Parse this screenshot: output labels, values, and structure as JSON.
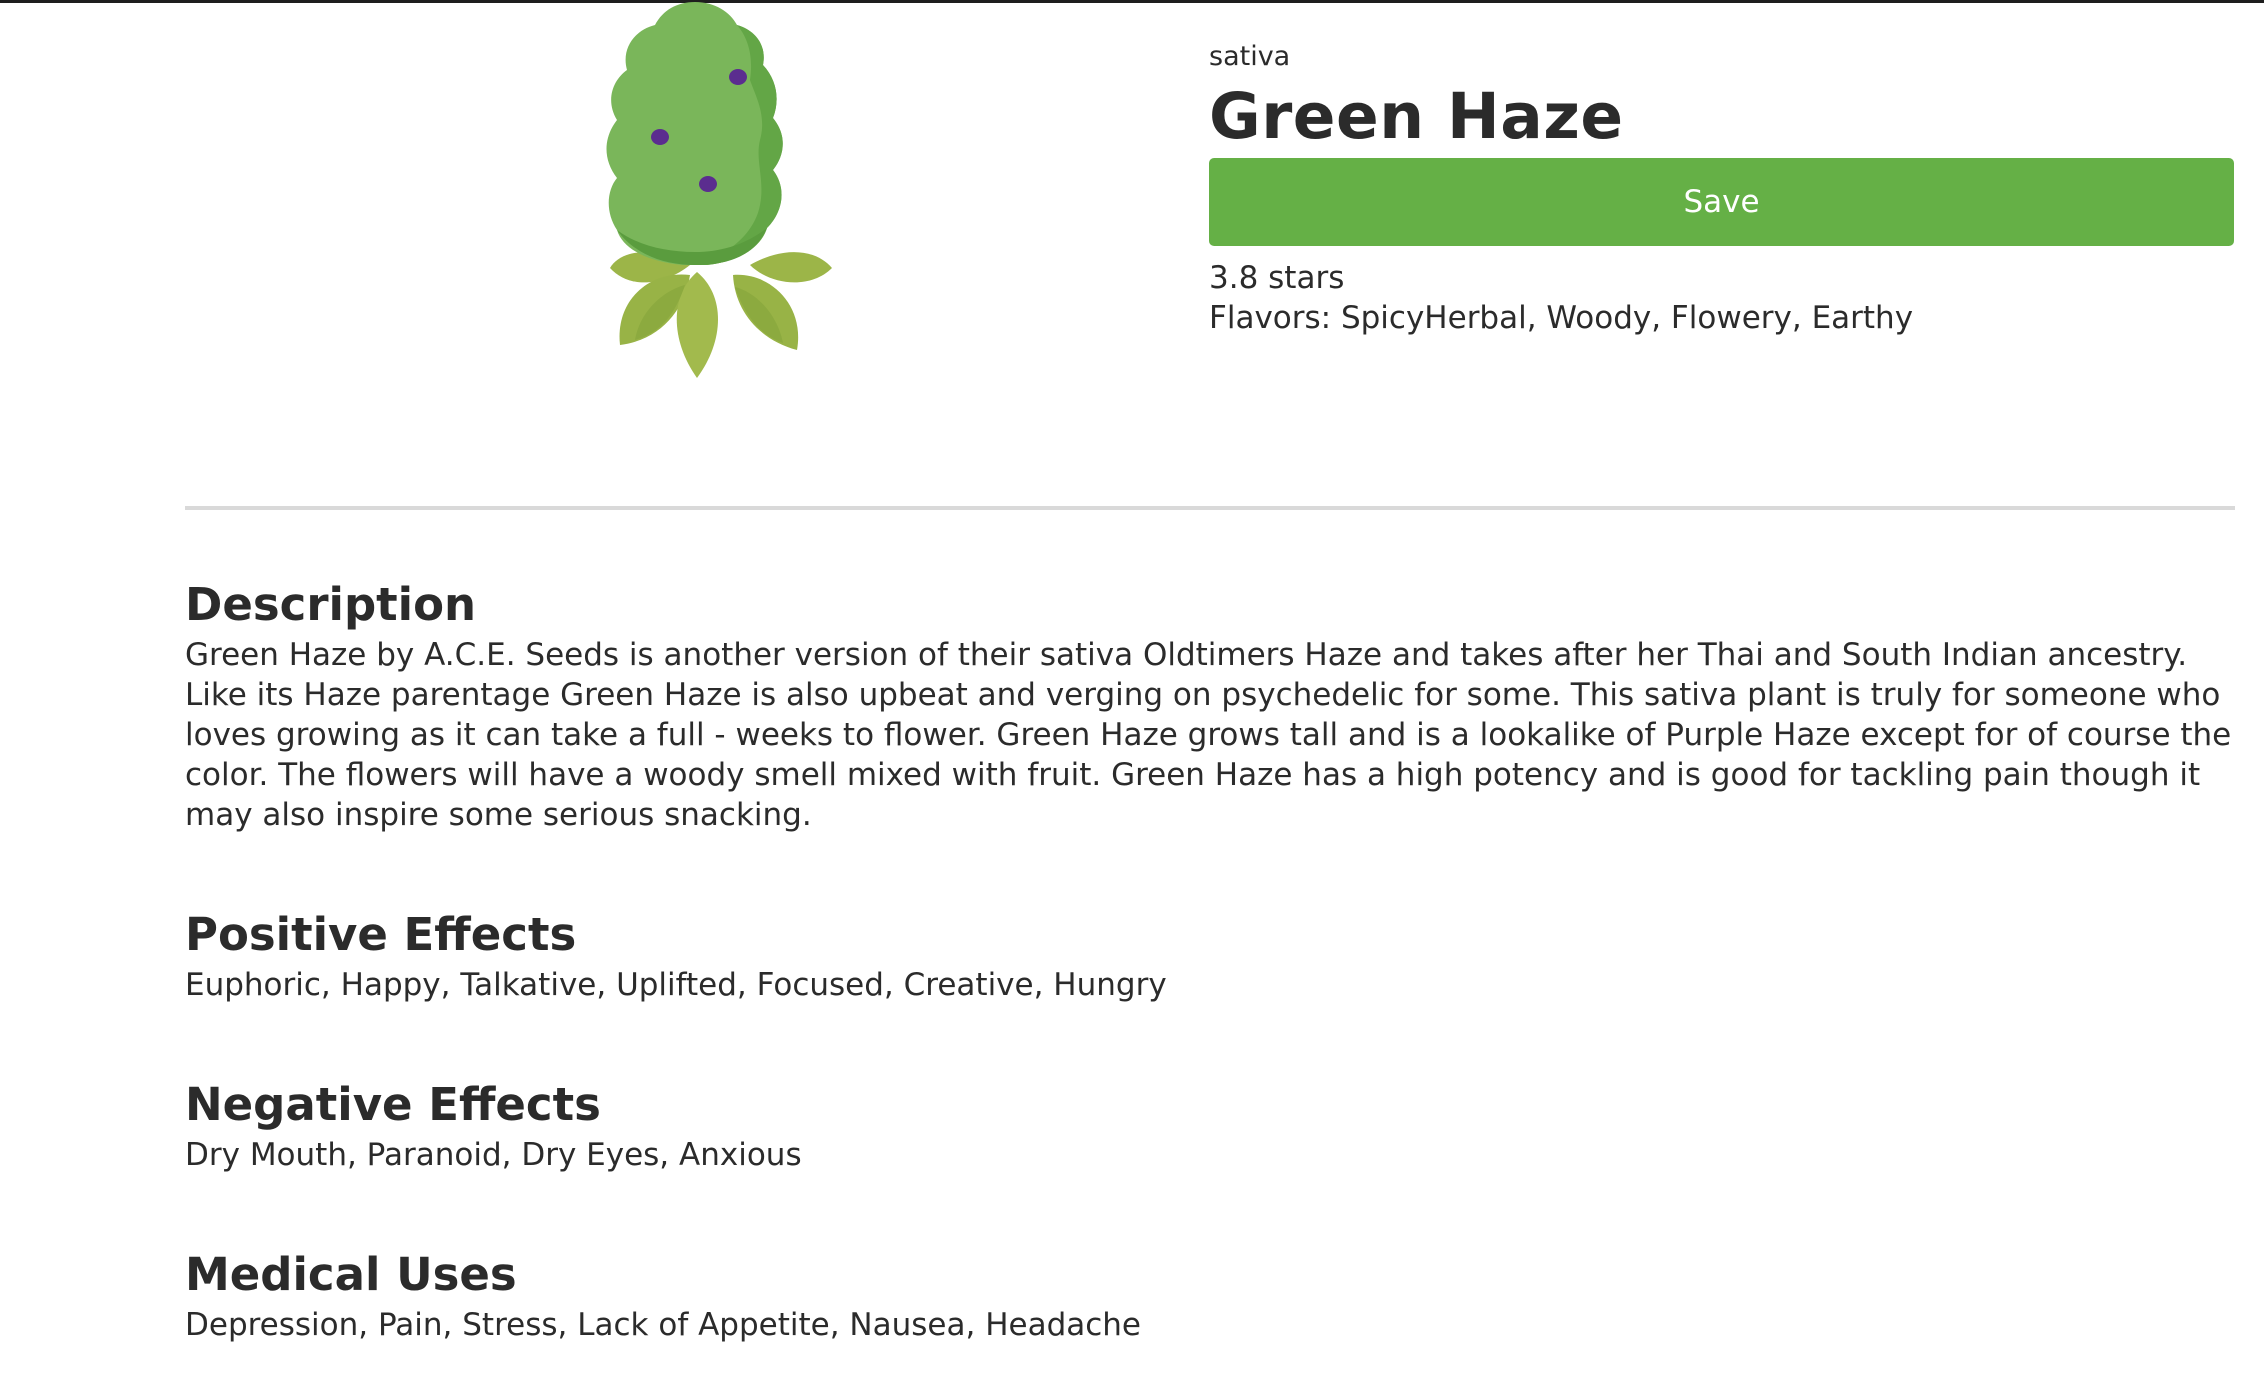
{
  "strain": {
    "type": "sativa",
    "name": "Green Haze",
    "save_label": "Save",
    "rating_text": "3.8 stars",
    "flavors_text": "Flavors: SpicyHerbal, Woody, Flowery, Earthy",
    "image_icon": "cannabis-bud-icon",
    "colors": {
      "save_button": "#65b046",
      "bud_light": "#7ab65a",
      "bud_dark": "#62a545",
      "leaf": "#9cb548",
      "spots": "#5b2d8f"
    }
  },
  "sections": {
    "description": {
      "title": "Description",
      "text": "Green Haze by A.C.E. Seeds is another version of their sativa Oldtimers Haze and takes after her Thai and South Indian ancestry. Like its Haze parentage Green Haze is also upbeat and verging on psychedelic for some. This sativa plant is truly for someone who loves growing as it can take a full - weeks to flower. Green Haze grows tall and is a lookalike of Purple Haze except for of course the color. The flowers will have a woody smell mixed with fruit. Green Haze has a high potency and is good for tackling pain though it may also inspire some serious snacking."
    },
    "positive": {
      "title": "Positive Effects",
      "text": "Euphoric, Happy, Talkative, Uplifted, Focused, Creative, Hungry"
    },
    "negative": {
      "title": "Negative Effects",
      "text": "Dry Mouth, Paranoid, Dry Eyes, Anxious"
    },
    "medical": {
      "title": "Medical Uses",
      "text": "Depression, Pain, Stress, Lack of Appetite, Nausea, Headache"
    }
  }
}
